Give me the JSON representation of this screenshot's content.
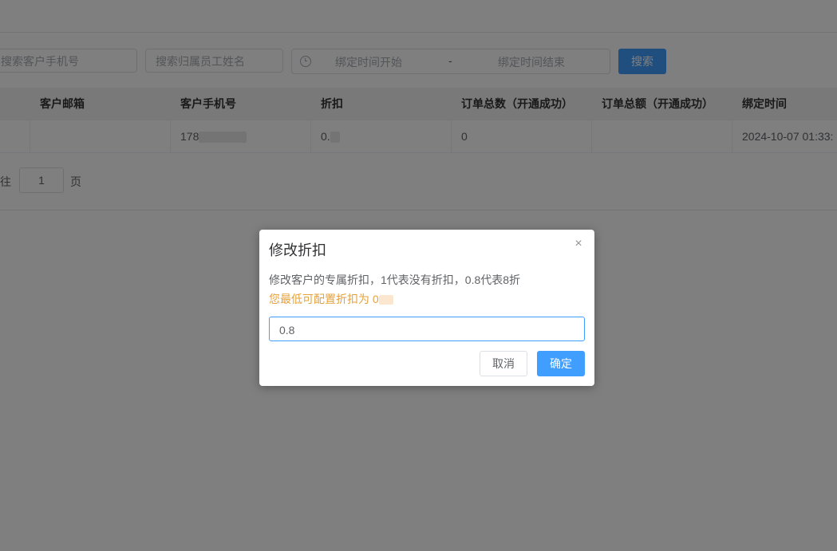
{
  "filters": {
    "customer_phone_placeholder": "搜索客户手机号",
    "employee_name_placeholder": "搜索归属员工姓名",
    "bind_start_placeholder": "绑定时间开始",
    "range_separator": "-",
    "bind_end_placeholder": "绑定时间结束",
    "search_label": "搜索"
  },
  "table": {
    "columns": [
      "客户邮箱",
      "客户手机号",
      "折扣",
      "订单总数（开通成功）",
      "订单总额（开通成功）",
      "绑定时间"
    ],
    "rows": [
      {
        "email": "",
        "phone": "178",
        "discount": "0.",
        "order_count": "0",
        "order_amount": "",
        "bind_time": "2024-10-07 01:33:"
      }
    ]
  },
  "pager": {
    "goto_prefix": "前往",
    "page_value": "1",
    "goto_suffix": "页"
  },
  "dialog": {
    "title": "修改折扣",
    "close_symbol": "×",
    "message": "修改客户的专属折扣，1代表没有折扣，0.8代表8折",
    "warning": "您最低可配置折扣为 0",
    "input_value": "0.8",
    "cancel_label": "取消",
    "confirm_label": "确定"
  },
  "colors": {
    "primary": "#409eff",
    "warning": "#e6a23c",
    "overlay": "rgba(0,0,0,0.5)"
  }
}
